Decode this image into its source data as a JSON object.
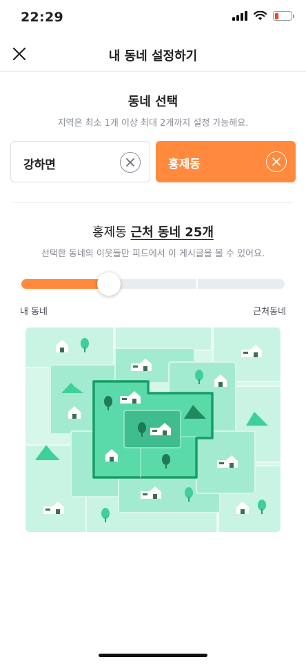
{
  "status_bar": {
    "time": "22:29",
    "battery_color": "#ff3b30"
  },
  "header": {
    "title": "내 동네 설정하기",
    "close_icon": "close-icon"
  },
  "area_selection": {
    "title": "동네 선택",
    "description": "지역은 최소 1개 이상 최대 2개까지 설정 가능해요.",
    "chips": [
      {
        "label": "강하면",
        "selected": false,
        "remove_icon": "remove-circle-icon"
      },
      {
        "label": "홍제동",
        "selected": true,
        "remove_icon": "remove-circle-icon"
      }
    ]
  },
  "range": {
    "area_name": "홍제동",
    "range_text": "근처 동네 25개",
    "description": "선택한 동네의 이웃들만 피드에서 이 게시글을 볼 수 있어요.",
    "slider": {
      "min_label": "내 동네",
      "max_label": "근처동네",
      "steps": 4,
      "level": 1
    }
  },
  "colors": {
    "accent": "#ff8a3d",
    "map_green": "#3fcf98",
    "map_border": "#17a66b"
  }
}
